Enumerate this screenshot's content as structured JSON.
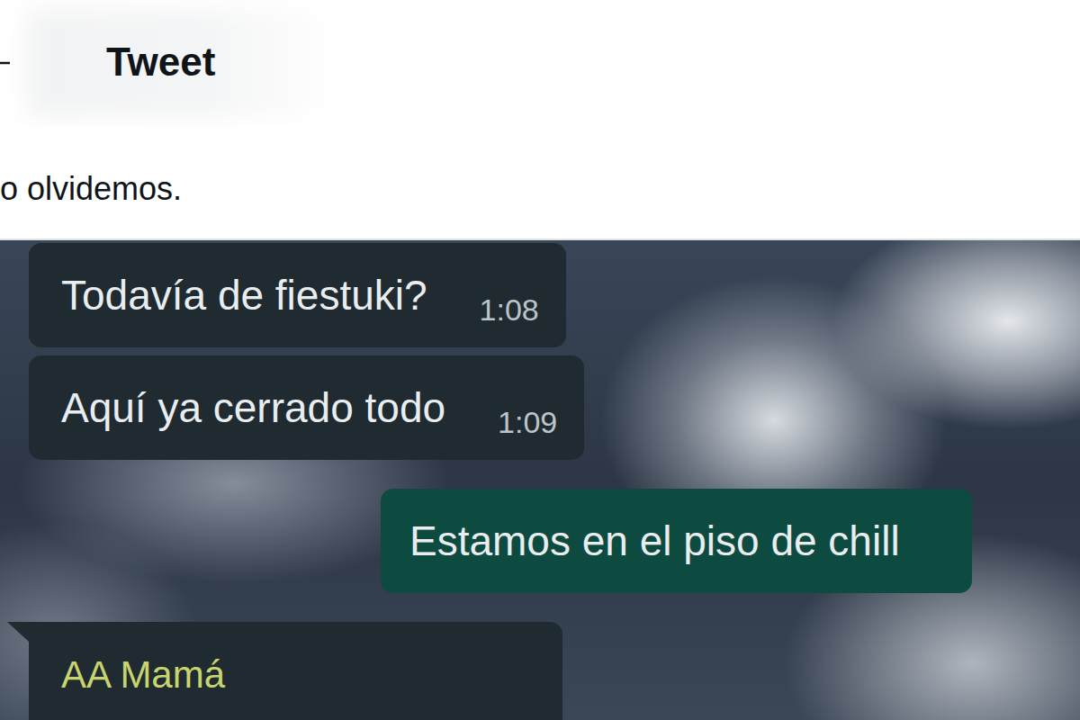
{
  "header": {
    "title": "Tweet"
  },
  "tweet": {
    "text": "o olvidemos."
  },
  "chat": {
    "messages": [
      {
        "kind": "incoming",
        "text": "Todavía de fiestuki?",
        "time": "1:08",
        "tail": false
      },
      {
        "kind": "incoming",
        "text": "Aquí ya cerrado todo",
        "time": "1:09",
        "tail": false
      },
      {
        "kind": "outgoing",
        "text": "Estamos en el piso de chill",
        "time": "",
        "tail": false
      },
      {
        "kind": "named",
        "sender": "AA Mamá",
        "text": "",
        "time": "",
        "tail": true
      }
    ]
  }
}
